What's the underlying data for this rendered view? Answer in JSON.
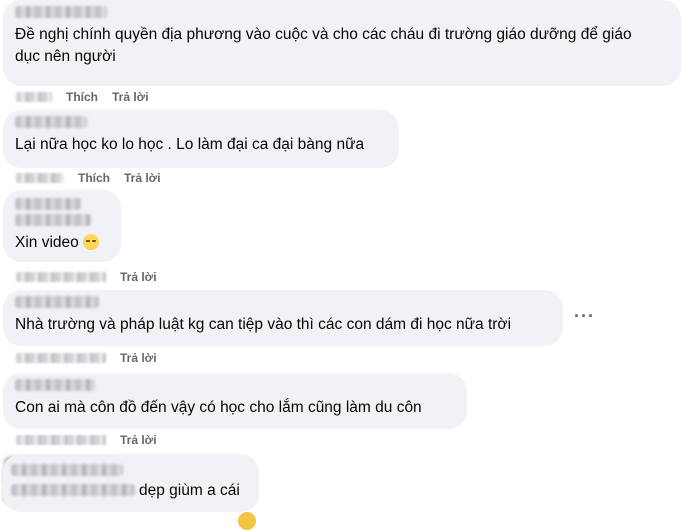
{
  "comments": [
    {
      "text": "Đề nghị chính quyền địa phương vào cuộc và cho các cháu đi trường giáo dưỡng để giáo dục nên người",
      "like": "Thích",
      "reply": "Trả lời"
    },
    {
      "text": "Lại nữa học ko lo học . Lo làm đại ca đại bàng nữa",
      "like": "Thích",
      "reply": "Trả lời"
    },
    {
      "text": "Xin video",
      "emoji": "slightly-sad-face-emoji",
      "reply": "Trả lời"
    },
    {
      "text": "Nhà trường và pháp luật kg can tiệp vào thì các con dám đi học nữa trời",
      "reply": "Trả lời",
      "more": "···"
    },
    {
      "text": "Con ai mà côn đồ đến vậy có học cho lắm cũng làm du côn",
      "reply": "Trả lời"
    },
    {
      "text": "dẹp giùm a cái"
    }
  ],
  "colors": {
    "bubble": "#f0f2f5",
    "text": "#050505",
    "meta": "#65676b"
  }
}
